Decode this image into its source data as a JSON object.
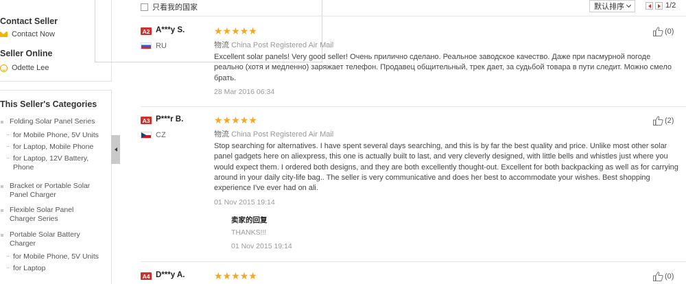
{
  "sidebar": {
    "contact_title": "Contact Seller",
    "contact_link": "Contact Now",
    "online_title": "Seller Online",
    "online_name": "Odette Lee",
    "categories_title": "This Seller's Categories",
    "categories": [
      {
        "label": "Folding Solar Panel Series",
        "level": "main"
      },
      {
        "label": "for Mobile Phone, 5V Units",
        "level": "sub"
      },
      {
        "label": "for Laptop, Mobile Phone",
        "level": "sub"
      },
      {
        "label": "for Laptop, 12V Battery, Phone",
        "level": "sub"
      },
      {
        "label": "Bracket or Portable Solar Panel Charger",
        "level": "main"
      },
      {
        "label": "Flexible Solar Panel Charger Series",
        "level": "main"
      },
      {
        "label": "Portable Solar Battery Charger",
        "level": "main"
      },
      {
        "label": "for Mobile Phone, 5V Units",
        "level": "sub"
      },
      {
        "label": "for Laptop",
        "level": "sub"
      }
    ]
  },
  "toolbar": {
    "filter_label": "只看我的国家",
    "sort_label": "默认排序",
    "page_text": "1/2"
  },
  "reviews": [
    {
      "level": "A2",
      "name": "A***y S.",
      "country": "RU",
      "stars": "★★★★★",
      "ship_label": "物流",
      "ship_value": "China Post Registered Air Mail",
      "text": "Excellent solar panels! Very good seller! Очень прилично сделано. Реальное заводское качество. Даже при пасмурной погоде реально (хотя и медленно) заряжает телефон. Продавец общительный, трек дает, за судьбой товара в пути следит. Можно смело брать.",
      "date": "28 Mar 2016 06:34",
      "helpful": "(0)"
    },
    {
      "level": "A3",
      "name": "P***r B.",
      "country": "CZ",
      "stars": "★★★★★",
      "ship_label": "物流",
      "ship_value": "China Post Registered Air Mail",
      "text": "Stop searching for alternatives. I have spent several days searching, and this is by far the best quality and price. Unlike most other solar panel gadgets here on aliexpress, this one is actually built to last, and very cleverly designed, with little bells and whistles just where you would expect them. I ordered both designs, and they are both excellently thought-out. Excellent for both backpacking as well as for carrying around in your daily city-life bag.. The seller is very communicative and does her best to accommodate your wishes. Best shopping experience I've ever had on ali.",
      "date": "01 Nov 2015 19:14",
      "reply_title": "卖家的回复",
      "reply_text": "THANKS!!!",
      "reply_date": "01 Nov 2015 19:14",
      "helpful": "(2)"
    },
    {
      "level": "A4",
      "name": "D***y A.",
      "stars": "★★★★★",
      "helpful": "(0)"
    }
  ],
  "colors": {
    "star": "#f5a623",
    "level_badge": "#d0302a",
    "pager_arrow": "#cc3333"
  }
}
